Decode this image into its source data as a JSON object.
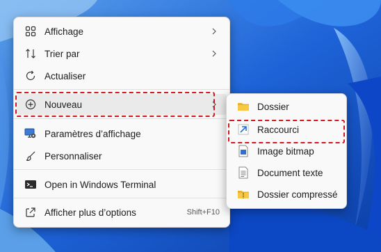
{
  "main_menu": {
    "items": [
      {
        "label": "Affichage",
        "icon": "grid-icon"
      },
      {
        "label": "Trier par",
        "icon": "sort-icon"
      },
      {
        "label": "Actualiser",
        "icon": "refresh-icon"
      },
      {
        "label": "Nouveau",
        "icon": "add-circle-icon"
      },
      {
        "label": "Paramètres d’affichage",
        "icon": "display-settings-icon"
      },
      {
        "label": "Personnaliser",
        "icon": "brush-icon"
      },
      {
        "label": "Open in Windows Terminal",
        "icon": "terminal-icon"
      },
      {
        "label": "Afficher plus d’options",
        "icon": "share-icon",
        "shortcut": "Shift+F10"
      }
    ]
  },
  "sub_menu": {
    "items": [
      {
        "label": "Dossier",
        "icon": "folder-icon"
      },
      {
        "label": "Raccourci",
        "icon": "shortcut-arrow-icon"
      },
      {
        "label": "Image bitmap",
        "icon": "bitmap-icon"
      },
      {
        "label": "Document texte",
        "icon": "text-document-icon"
      },
      {
        "label": "Dossier compressé",
        "icon": "zip-folder-icon"
      }
    ]
  },
  "colors": {
    "highlight_border": "#d4161c",
    "menu_background": "#f9f9f9",
    "wallpaper_blue": "#1b5fd6"
  }
}
